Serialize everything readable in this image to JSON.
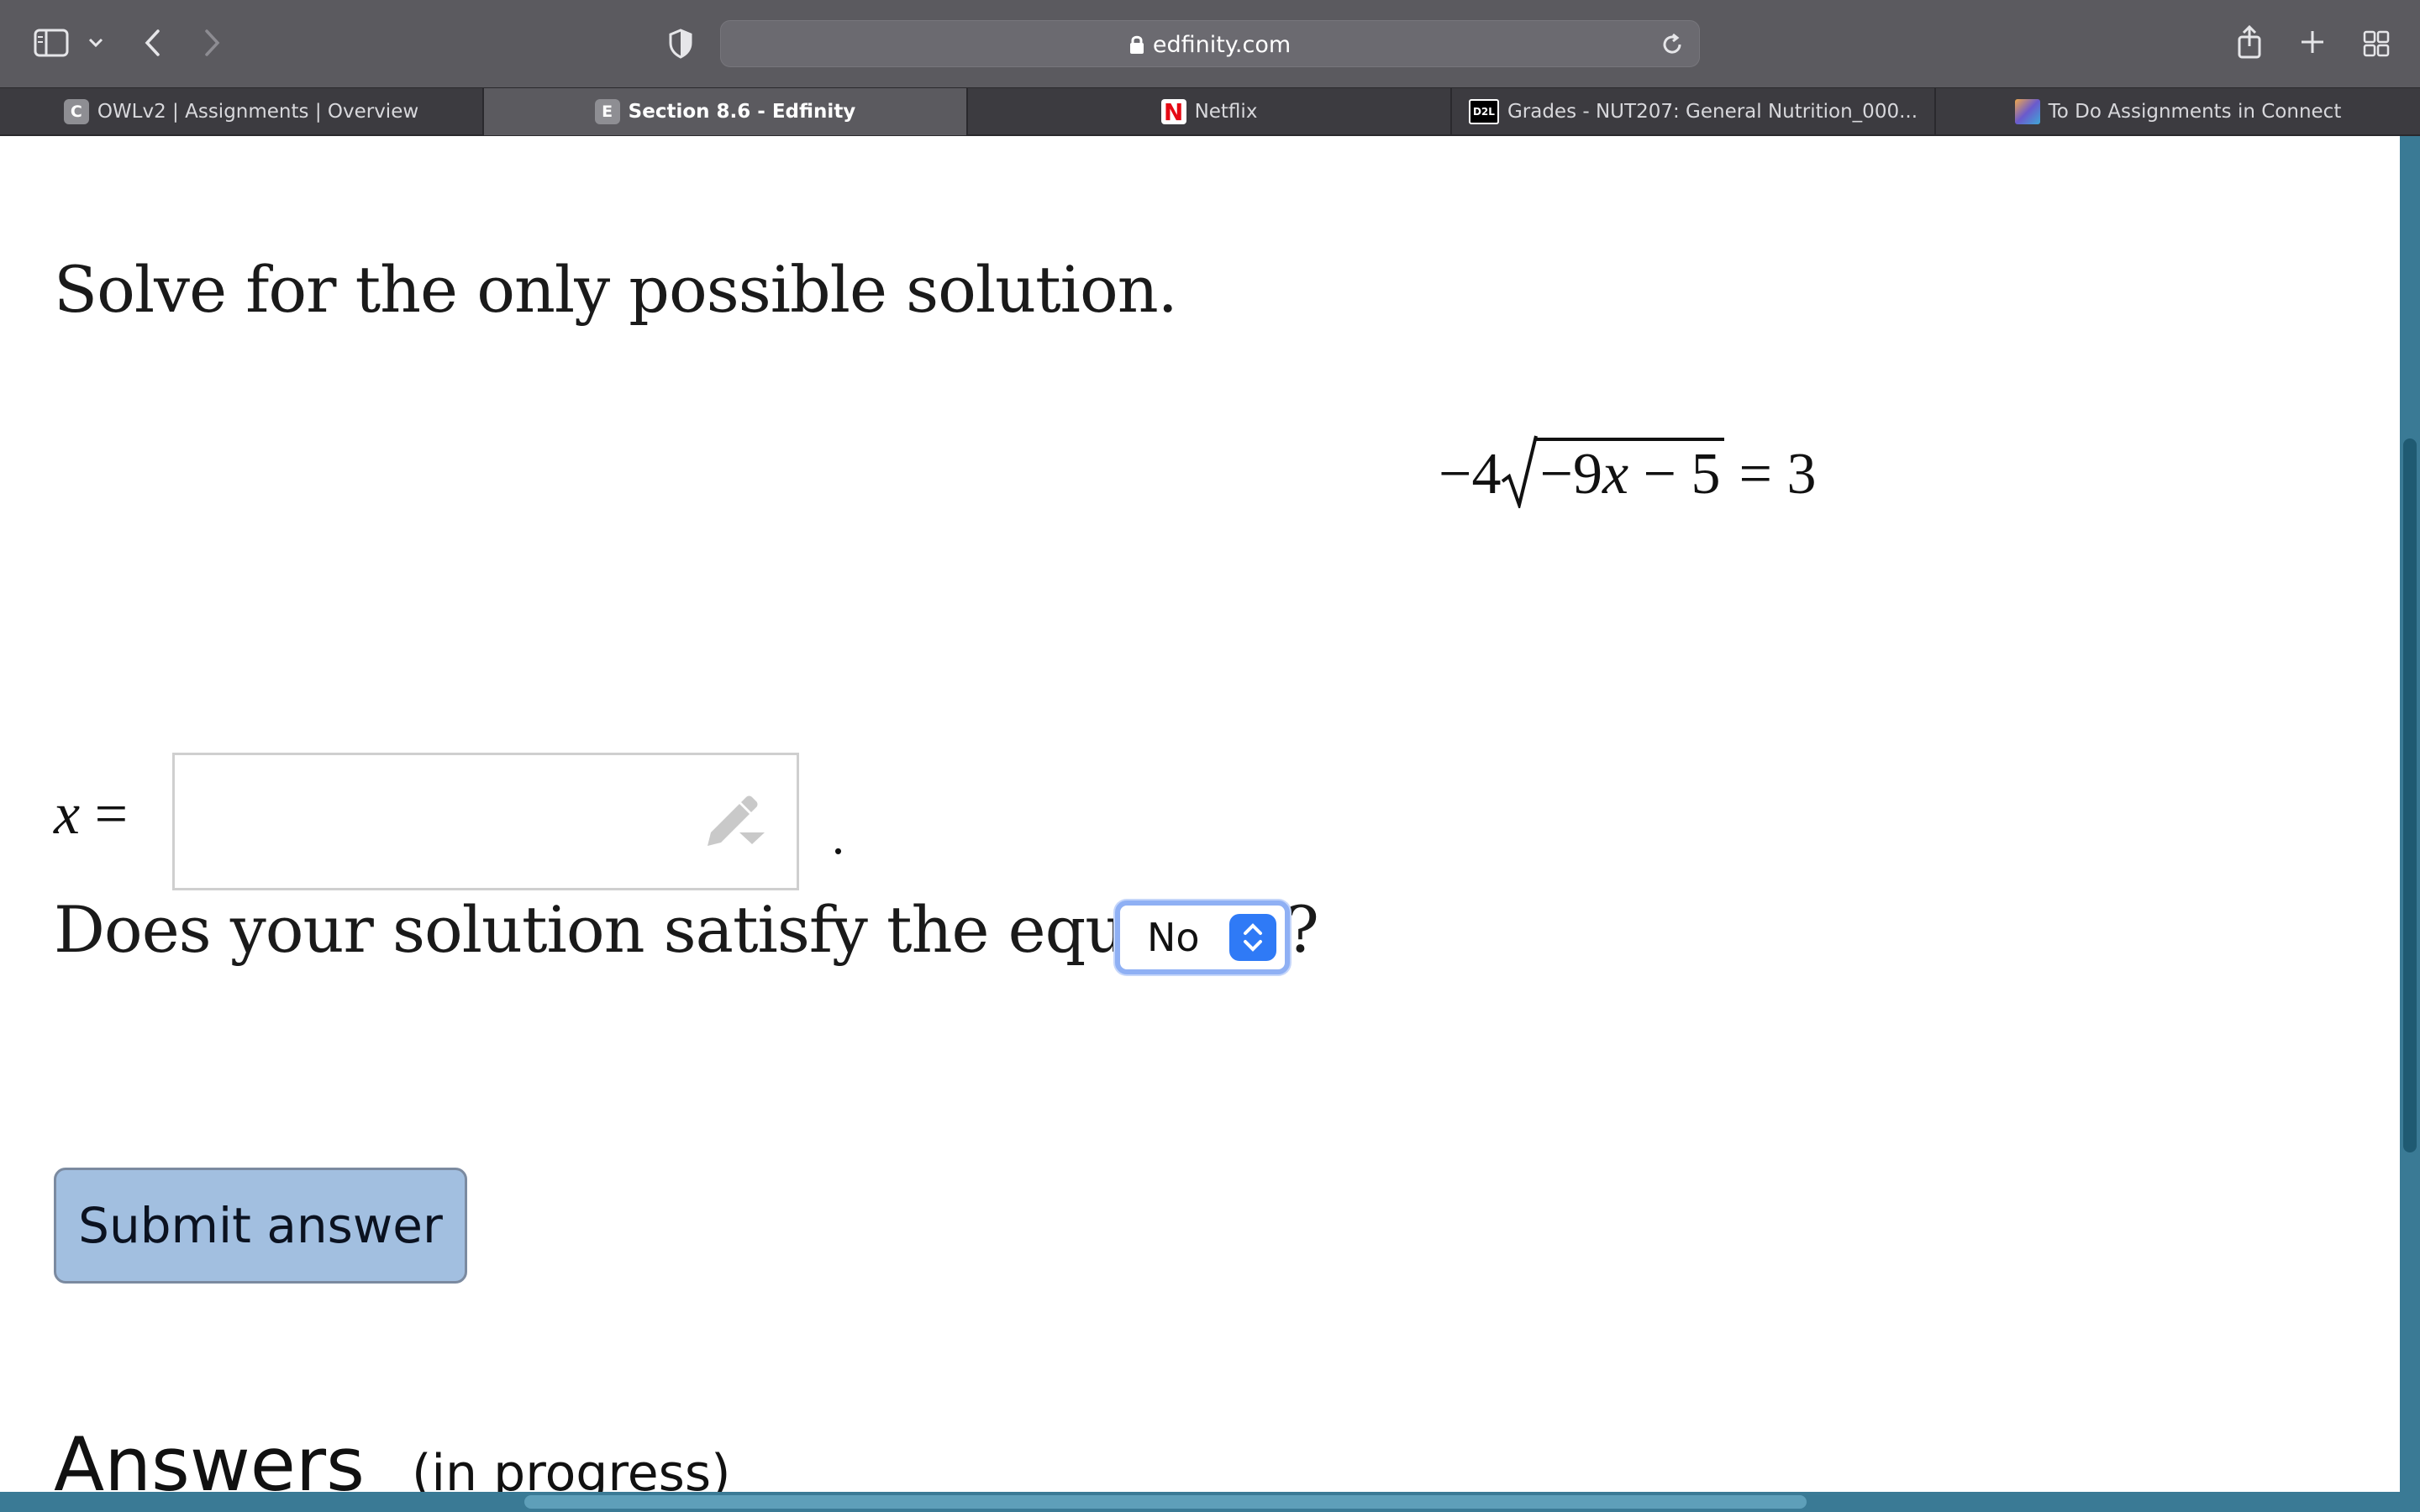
{
  "browser": {
    "url": "edfinity.com",
    "tabs": [
      {
        "label": "OWLv2 | Assignments | Overview",
        "favicon": "C",
        "favicon_bg": "#8e8e93",
        "active": false
      },
      {
        "label": "Section 8.6 - Edfinity",
        "favicon": "E",
        "favicon_bg": "#8e8e93",
        "active": true
      },
      {
        "label": "Netflix",
        "favicon": "N",
        "favicon_bg": "#e50914",
        "active": false
      },
      {
        "label": "Grades - NUT207: General Nutrition_000...",
        "favicon": "D2L",
        "favicon_bg": "#000000",
        "active": false
      },
      {
        "label": "To Do Assignments in Connect",
        "favicon": "",
        "favicon_bg": "#6a5acd",
        "active": false
      }
    ]
  },
  "problem": {
    "prompt": "Solve for the only possible solution.",
    "equation": {
      "coefficient": "−4",
      "radicand_coef": "−9",
      "radicand_var": "x",
      "radicand_rest": " − 5",
      "rhs": "= 3"
    },
    "answer_var": "x",
    "answer_eq": " =",
    "answer_value": "",
    "period": ".",
    "question": "Does your solution satisfy the equation?",
    "select_value": "No",
    "submit_label": "Submit answer"
  },
  "answers": {
    "heading": "Answers",
    "status": "(in progress)"
  },
  "colors": {
    "accent": "#2f7af6",
    "submit_bg": "#a2bfe0",
    "scrollbar": "#3a7a95"
  }
}
